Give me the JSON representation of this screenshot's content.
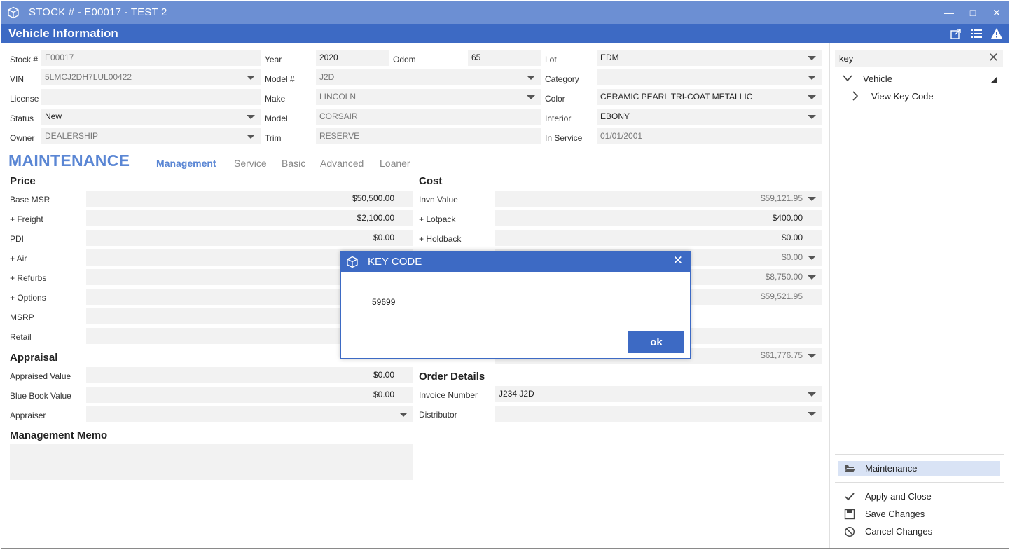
{
  "window": {
    "title": "STOCK # - E00017 - TEST 2",
    "controls": {
      "minimize": "—",
      "maximize": "□",
      "close": "✕"
    }
  },
  "header": {
    "title": "Vehicle Information"
  },
  "vehicle": {
    "stock_label": "Stock #",
    "stock_value": "E00017",
    "vin_label": "VIN",
    "vin_value": "5LMCJ2DH7LUL00422",
    "license_label": "License",
    "license_value": "",
    "status_label": "Status",
    "status_value": "New",
    "owner_label": "Owner",
    "owner_value": "DEALERSHIP",
    "year_label": "Year",
    "year_value": "2020",
    "odom_label": "Odom",
    "odom_value": "65",
    "model_num_label": "Model #",
    "model_num_value": "J2D",
    "make_label": "Make",
    "make_value": "LINCOLN",
    "model_label": "Model",
    "model_value": "CORSAIR",
    "trim_label": "Trim",
    "trim_value": "RESERVE",
    "lot_label": "Lot",
    "lot_value": "EDM",
    "category_label": "Category",
    "category_value": "",
    "color_label": "Color",
    "color_value": "CERAMIC PEARL TRI-COAT METALLIC",
    "interior_label": "Interior",
    "interior_value": "EBONY",
    "in_service_label": "In Service",
    "in_service_value": "01/01/2001"
  },
  "maintenance": {
    "title": "MAINTENANCE",
    "tabs": [
      "Management",
      "Service",
      "Basic",
      "Advanced",
      "Loaner"
    ],
    "active_tab": "Management"
  },
  "price": {
    "title": "Price",
    "rows": [
      {
        "label": "Base MSR",
        "value": "$50,500.00"
      },
      {
        "label": "+ Freight",
        "value": "$2,100.00"
      },
      {
        "label": "PDI",
        "value": "$0.00"
      },
      {
        "label": "+ Air",
        "value": ""
      },
      {
        "label": "+ Refurbs",
        "value": ""
      },
      {
        "label": "+ Options",
        "value": ""
      },
      {
        "label": "MSRP",
        "value": ""
      },
      {
        "label": "Retail",
        "value": ""
      }
    ]
  },
  "cost": {
    "title": "Cost",
    "rows": [
      {
        "label": "Invn Value",
        "value": "$59,121.95"
      },
      {
        "label": "+ Lotpack",
        "value": "$400.00"
      },
      {
        "label": "+ Holdback",
        "value": "$0.00"
      },
      {
        "label": "",
        "value": "$0.00"
      },
      {
        "label": "",
        "value": "$8,750.00"
      },
      {
        "label": "",
        "value": "$59,521.95"
      },
      {
        "label": "",
        "value": ""
      },
      {
        "label": "",
        "value": ""
      },
      {
        "label": "",
        "value": "$61,776.75"
      }
    ]
  },
  "appraisal": {
    "title": "Appraisal",
    "rows": [
      {
        "label": "Appraised Value",
        "value": "$0.00"
      },
      {
        "label": "Blue Book Value",
        "value": "$0.00"
      },
      {
        "label": "Appraiser",
        "value": ""
      }
    ]
  },
  "order": {
    "title": "Order Details",
    "rows": [
      {
        "label": "Invoice Number",
        "value": "J234 J2D"
      },
      {
        "label": "Distributor",
        "value": ""
      }
    ]
  },
  "memo": {
    "title": "Management Memo",
    "value": ""
  },
  "side": {
    "search_value": "key",
    "clear": "✕",
    "tree": [
      {
        "label": "Vehicle",
        "expanded": true
      },
      {
        "label": "View Key Code",
        "expanded": false
      }
    ],
    "nav_item": "Maintenance",
    "actions": [
      "Apply and Close",
      "Save Changes",
      "Cancel Changes"
    ]
  },
  "dialog": {
    "title": "KEY CODE",
    "value": "59699",
    "ok_label": "ok",
    "close": "✕"
  },
  "colors": {
    "titlebar": "#6c8fd3",
    "header": "#3d6ac4",
    "accent": "#5a86d4",
    "field_bg": "#f2f2f2",
    "nav_selected": "#d9e3f5"
  }
}
